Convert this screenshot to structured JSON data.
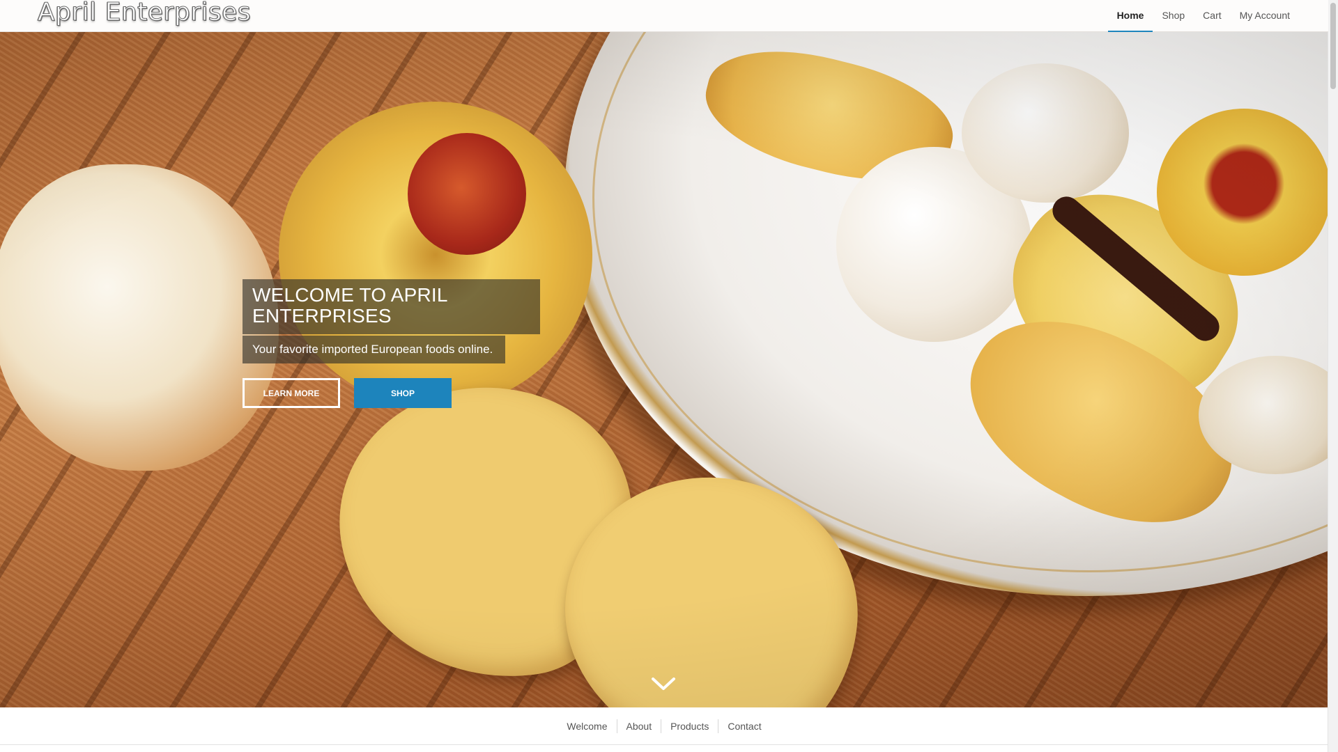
{
  "header": {
    "logo_text": "April Enterprises",
    "nav": [
      {
        "label": "Home",
        "active": true
      },
      {
        "label": "Shop",
        "active": false
      },
      {
        "label": "Cart",
        "active": false
      },
      {
        "label": "My Account",
        "active": false
      }
    ]
  },
  "hero": {
    "title": "WELCOME TO APRIL ENTERPRISES",
    "subtitle": "Your favorite imported European foods online.",
    "buttons": {
      "learn_more": "LEARN MORE",
      "shop": "SHOP"
    },
    "scroll_icon": "chevron-down-icon"
  },
  "section_nav": {
    "items": [
      "Welcome",
      "About",
      "Products",
      "Contact"
    ]
  },
  "colors": {
    "accent": "#1d84bc",
    "header_bg": "#fdfcfb",
    "caption_bg": "rgba(45,45,40,0.62)"
  }
}
